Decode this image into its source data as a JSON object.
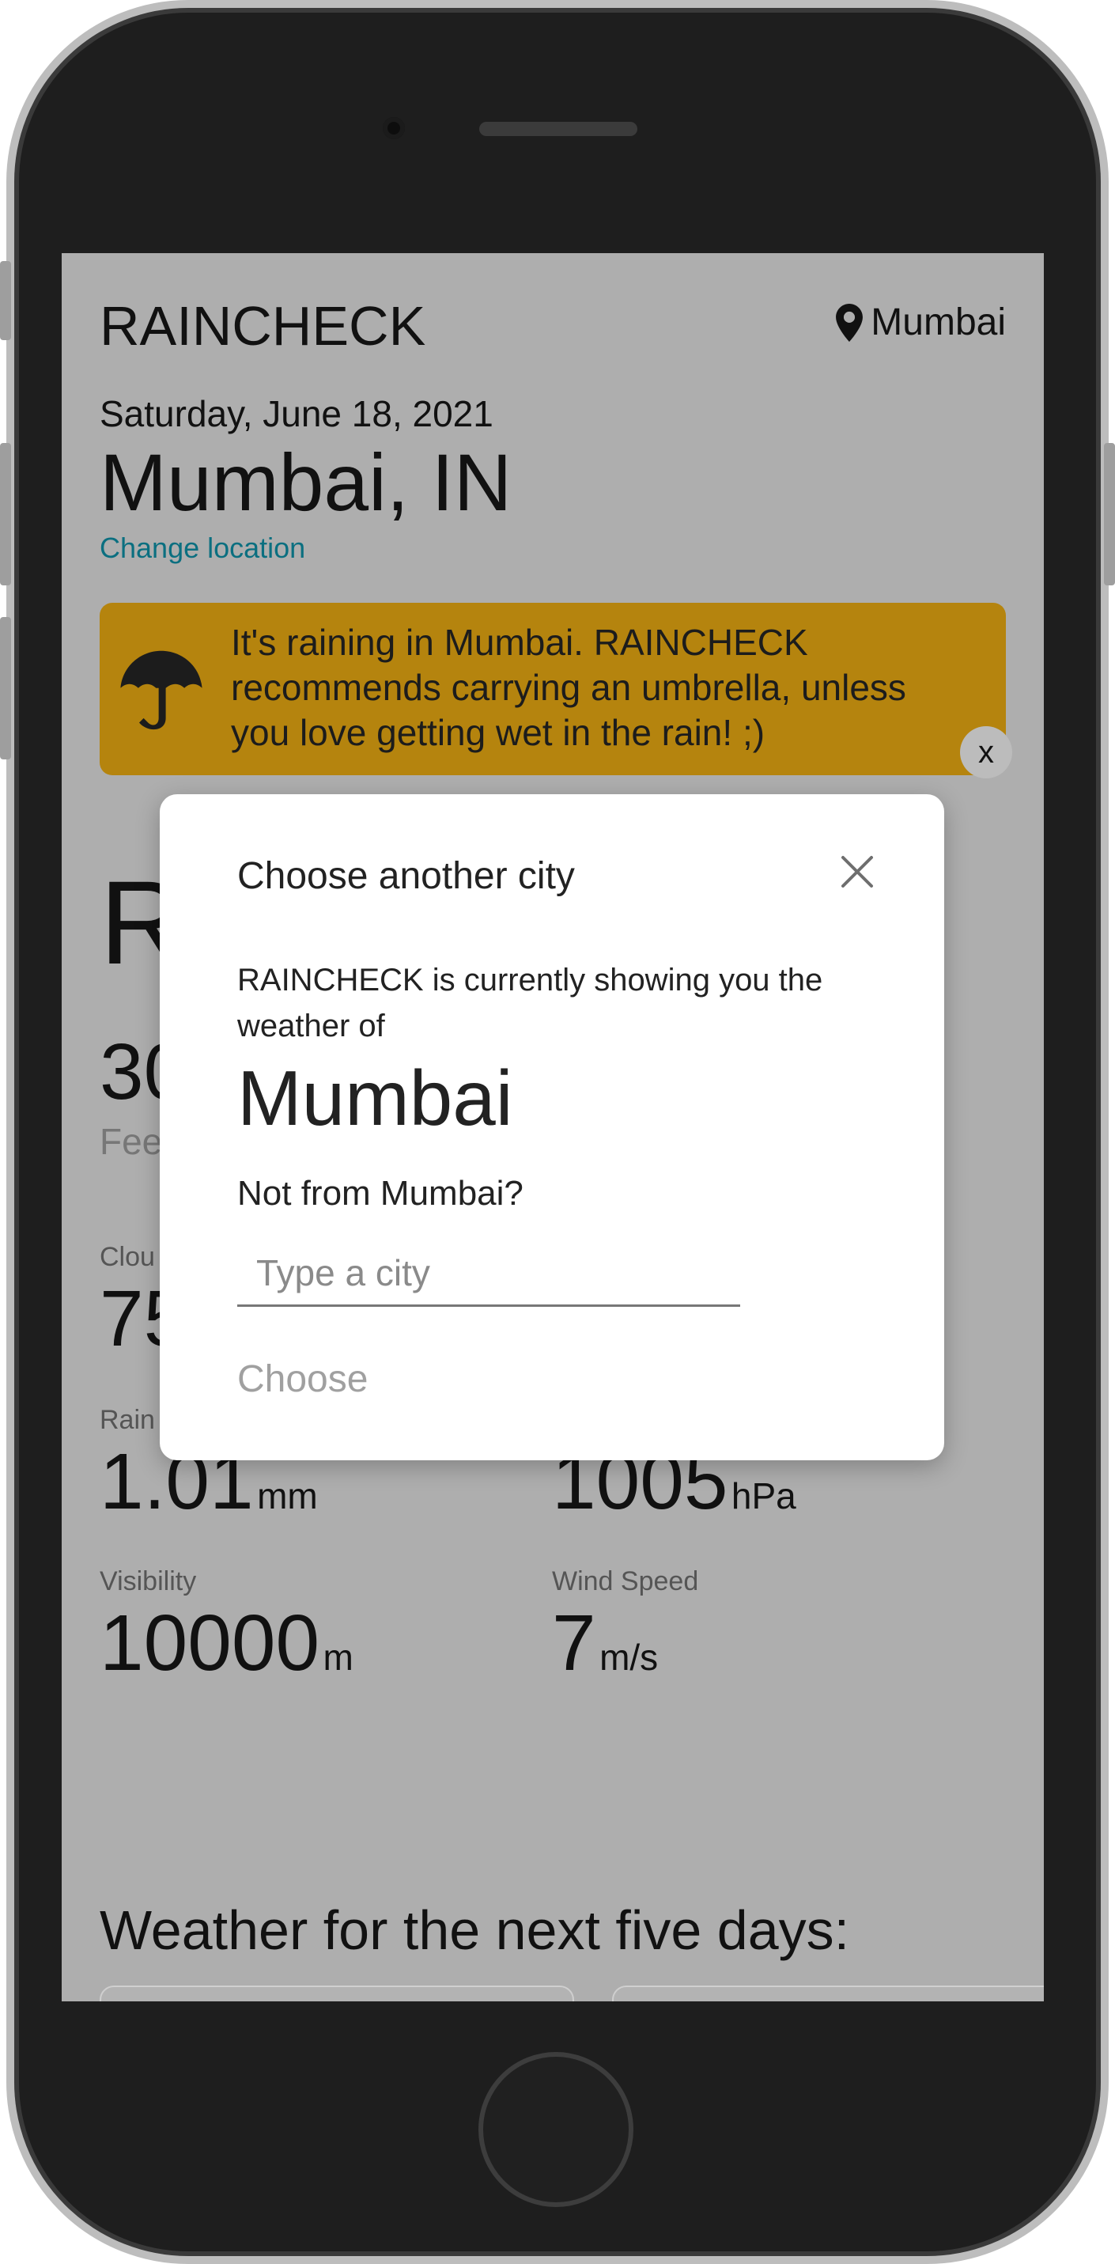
{
  "header": {
    "app_title": "RAINCHECK",
    "location_label": "Mumbai",
    "location_icon": "map-pin-icon"
  },
  "current": {
    "date": "Saturday, June 18, 2021",
    "city": "Mumbai, IN",
    "change_location": "Change location",
    "condition_partial": "R",
    "temp_partial": "30",
    "feels_partial": "Fee"
  },
  "alert": {
    "icon": "umbrella-icon",
    "text": "It's raining in Mumbai. RAINCHECK recommends carrying an umbrella, unless you love getting wet in the rain! ;)",
    "dismiss": "x",
    "color": "#b5840e"
  },
  "stats": {
    "cloud_label_partial": "Clou",
    "cloud_value_partial": "75",
    "rain_label": "Rain",
    "rain_value": "1.01",
    "rain_unit": "mm",
    "pressure_value": "1005",
    "pressure_unit": "hPa",
    "visibility_label": "Visibility",
    "visibility_value": "10000",
    "visibility_unit": "m",
    "wind_label": "Wind Speed",
    "wind_value": "7",
    "wind_unit": "m/s"
  },
  "forecast": {
    "title": "Weather for the next five days:"
  },
  "modal": {
    "title": "Choose another city",
    "close_icon": "close-icon",
    "description": "RAINCHECK is currently showing you the weather of",
    "city": "Mumbai",
    "not_from": "Not from Mumbai?",
    "input_placeholder": "Type a city",
    "input_value": "",
    "choose_button": "Choose"
  }
}
